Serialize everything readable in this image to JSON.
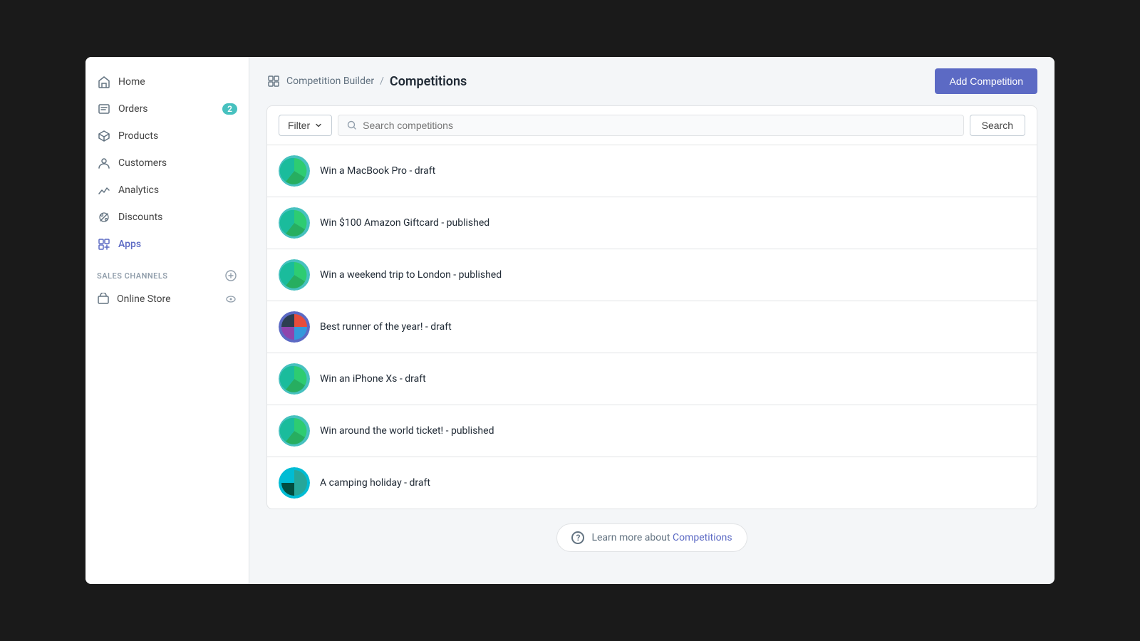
{
  "sidebar": {
    "items": [
      {
        "id": "home",
        "label": "Home",
        "icon": "home-icon",
        "badge": null,
        "active": false
      },
      {
        "id": "orders",
        "label": "Orders",
        "icon": "orders-icon",
        "badge": "2",
        "active": false
      },
      {
        "id": "products",
        "label": "Products",
        "icon": "products-icon",
        "badge": null,
        "active": false
      },
      {
        "id": "customers",
        "label": "Customers",
        "icon": "customers-icon",
        "badge": null,
        "active": false
      },
      {
        "id": "analytics",
        "label": "Analytics",
        "icon": "analytics-icon",
        "badge": null,
        "active": false
      },
      {
        "id": "discounts",
        "label": "Discounts",
        "icon": "discounts-icon",
        "badge": null,
        "active": false
      },
      {
        "id": "apps",
        "label": "Apps",
        "icon": "apps-icon",
        "badge": null,
        "active": true
      }
    ],
    "sales_channels_label": "SALES CHANNELS",
    "online_store_label": "Online Store"
  },
  "header": {
    "breadcrumb_root": "Competition Builder",
    "breadcrumb_separator": "/",
    "page_title": "Competitions",
    "add_button_label": "Add Competition"
  },
  "search": {
    "filter_label": "Filter",
    "search_placeholder": "Search competitions",
    "search_button_label": "Search"
  },
  "competitions": [
    {
      "id": 1,
      "title": "Win a MacBook Pro - draft",
      "avatar_type": "green-pie"
    },
    {
      "id": 2,
      "title": "Win $100 Amazon Giftcard - published",
      "avatar_type": "green-pie"
    },
    {
      "id": 3,
      "title": "Win a weekend trip to London - published",
      "avatar_type": "green-pie"
    },
    {
      "id": 4,
      "title": "Best runner of the year! - draft",
      "avatar_type": "blue-mixed"
    },
    {
      "id": 5,
      "title": "Win an iPhone Xs - draft",
      "avatar_type": "green-pie"
    },
    {
      "id": 6,
      "title": "Win around the world ticket! - published",
      "avatar_type": "green-pie"
    },
    {
      "id": 7,
      "title": "A camping holiday - draft",
      "avatar_type": "teal-mixed"
    }
  ],
  "footer": {
    "text": "Learn more about",
    "link_text": "Competitions",
    "help_char": "?"
  }
}
